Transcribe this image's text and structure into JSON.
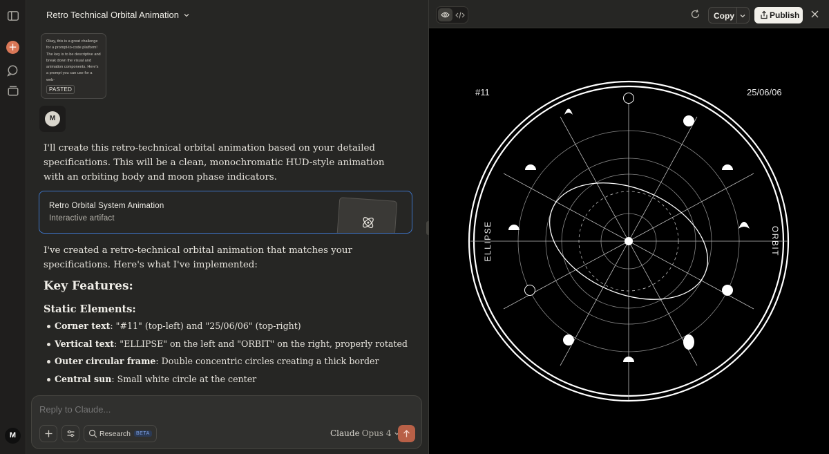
{
  "chat": {
    "title": "Retro Technical Orbital Animation",
    "pasted_preview": "Okay, this is a great challenge for a prompt-to-code platform! The key is to be descriptive and break down the visual and animation components. Here's a prompt you can use for a web-",
    "pasted_tag": "PASTED",
    "user_initial": "M",
    "intro": "I'll create this retro-technical orbital animation based on your detailed specifications. This will be a clean, monochromatic HUD-style animation with an orbiting body and moon phase indicators.",
    "artifact": {
      "name": "Retro Orbital System Animation",
      "subtitle": "Interactive artifact",
      "icon": "atom-icon"
    },
    "followup": "I've created a retro-technical orbital animation that matches your specifications. Here's what I've implemented:",
    "heading": "Key Features:",
    "subheading": "Static Elements:",
    "features": [
      {
        "term": "Corner text",
        "desc": ": \"#11\" (top-left) and \"25/06/06\" (top-right)"
      },
      {
        "term": "Vertical text",
        "desc": ": \"ELLIPSE\" on the left and \"ORBIT\" on the right, properly rotated"
      },
      {
        "term": "Outer circular frame",
        "desc": ": Double concentric circles creating a thick border"
      },
      {
        "term": "Central sun",
        "desc": ": Small white circle at the center"
      }
    ]
  },
  "composer": {
    "placeholder": "Reply to Claude...",
    "research_label": "Research",
    "research_badge": "BETA",
    "model_name": "Claude",
    "model_version": "Opus 4"
  },
  "preview": {
    "copy_label": "Copy",
    "publish_label": "Publish",
    "corner_left": "#11",
    "corner_right": "25/06/06",
    "vertical_left": "ELLIPSE",
    "vertical_right": "ORBIT",
    "colors": {
      "background": "#000000",
      "foreground": "#ffffff"
    }
  },
  "account": {
    "initial": "M"
  },
  "colors": {
    "accent": "#d97757",
    "artifact_border": "#3d74c7"
  }
}
